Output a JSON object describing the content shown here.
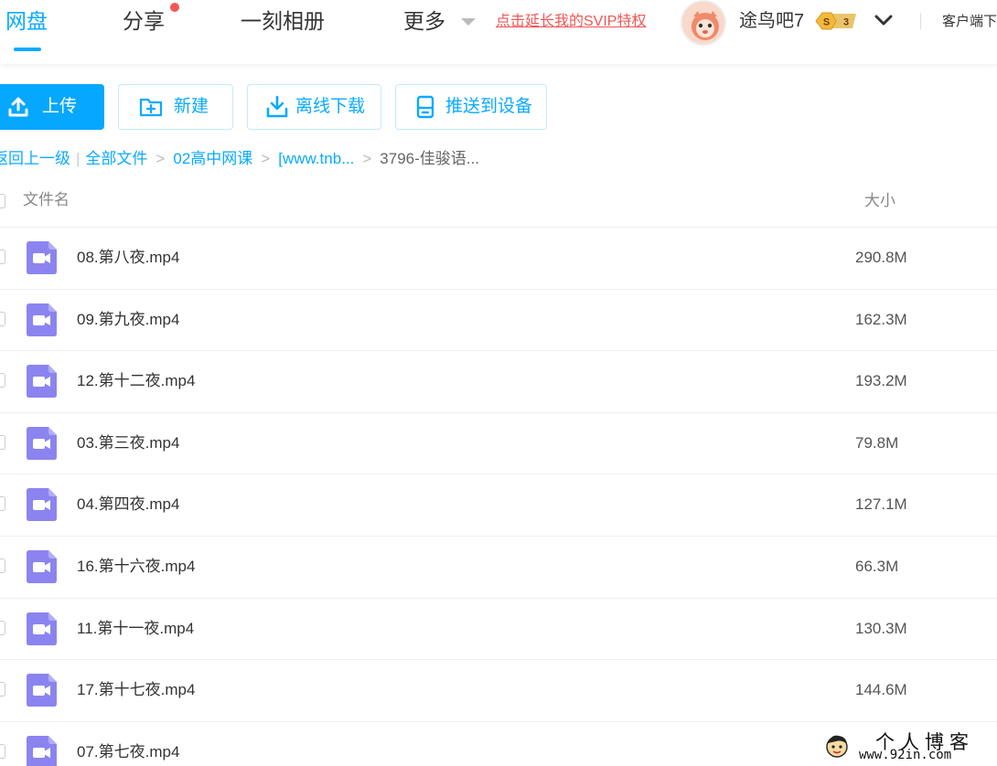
{
  "nav": {
    "tabs": [
      {
        "label": "网盘",
        "active": true
      },
      {
        "label": "分享",
        "has_dot": true
      },
      {
        "label": "一刻相册"
      },
      {
        "label": "更多"
      }
    ],
    "svip_link": "点击延长我的SVIP特权",
    "username": "途鸟吧7",
    "vip_level": "3",
    "vip_symbol": "S",
    "client_link": "客户端下载"
  },
  "toolbar": {
    "upload_label": "上传",
    "new_label": "新建",
    "offline_label": "离线下载",
    "push_label": "推送到设备"
  },
  "breadcrumb": {
    "back": "返回上一级",
    "items": [
      "全部文件",
      "02高中网课",
      "[www.tnb...",
      "3796-佳骏语..."
    ]
  },
  "list": {
    "columns": {
      "name": "文件名",
      "size": "大小"
    },
    "rows": [
      {
        "name": "08.第八夜.mp4",
        "size": "290.8M"
      },
      {
        "name": "09.第九夜.mp4",
        "size": "162.3M"
      },
      {
        "name": "12.第十二夜.mp4",
        "size": "193.2M"
      },
      {
        "name": "03.第三夜.mp4",
        "size": "79.8M"
      },
      {
        "name": "04.第四夜.mp4",
        "size": "127.1M"
      },
      {
        "name": "16.第十六夜.mp4",
        "size": "66.3M"
      },
      {
        "name": "11.第十一夜.mp4",
        "size": "130.3M"
      },
      {
        "name": "17.第十七夜.mp4",
        "size": "144.6M"
      },
      {
        "name": "07.第七夜.mp4",
        "size": ""
      }
    ]
  },
  "watermark": {
    "title": "个人博客",
    "url": "www.92in.com"
  },
  "colors": {
    "accent": "#09aaff",
    "svip_red": "#f25555",
    "video_icon": "#8b84f0"
  },
  "icons": {
    "file": "video-file-icon",
    "upload": "upload-icon",
    "new": "new-folder-icon",
    "offline": "download-icon",
    "push": "device-icon"
  }
}
